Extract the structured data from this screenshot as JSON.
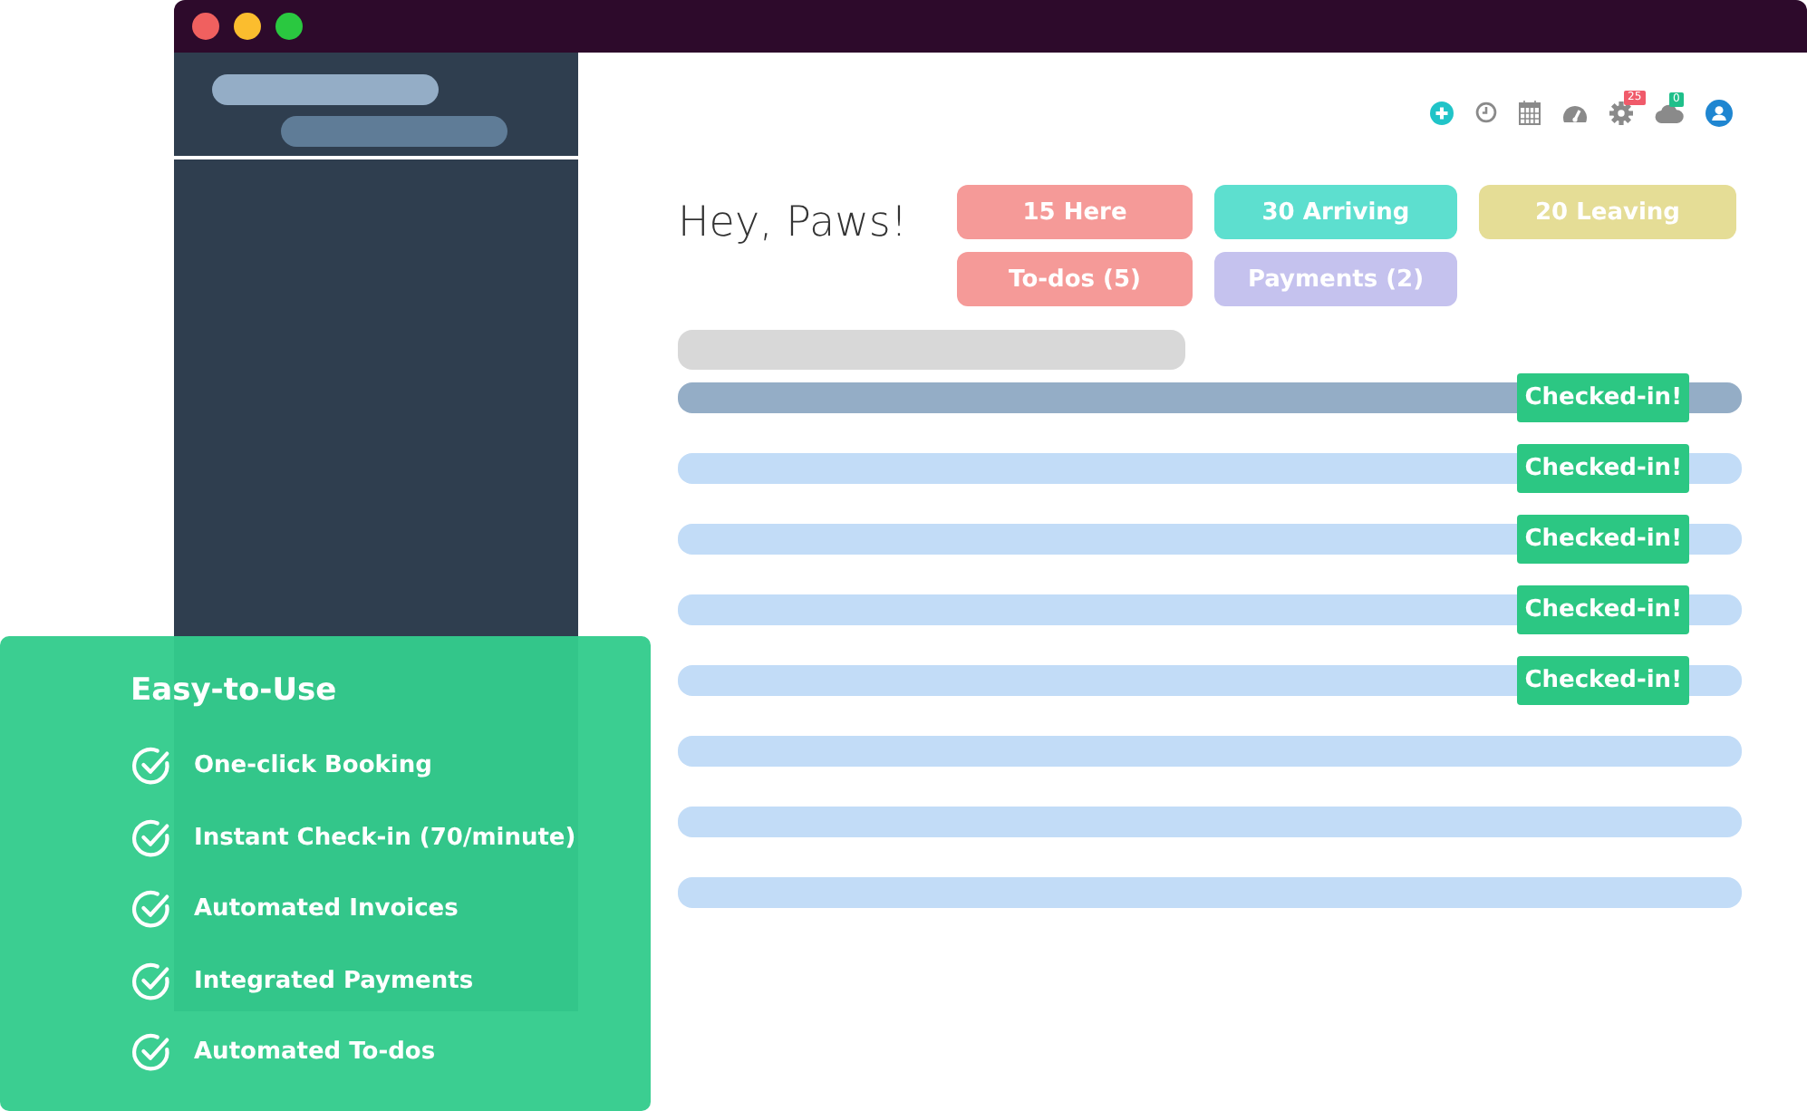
{
  "toolbar": [
    {
      "kind": "add"
    },
    {
      "kind": "clock"
    },
    {
      "kind": "calendar"
    },
    {
      "kind": "gauge"
    },
    {
      "kind": "settings",
      "badge": "25",
      "color": "#f05a6a"
    },
    {
      "kind": "cloud",
      "badge": "0",
      "color": "#1fbf8a"
    },
    {
      "kind": "user"
    }
  ],
  "greeting": "Hey, Paws!",
  "stats": [
    {
      "label": "15 Here",
      "color": "#f59a98"
    },
    {
      "label": "30 Arriving",
      "color": "#5ddfcf"
    },
    {
      "label": "20 Leaving",
      "color": "#e5dd96"
    },
    {
      "label": "To-dos (5)",
      "color": "#f59a98"
    },
    {
      "label": "Payments (2)",
      "color": "#c5c2ee"
    }
  ],
  "rows": [
    {
      "selected": true,
      "status": "Checked-in!"
    },
    {
      "selected": false,
      "status": "Checked-in!"
    },
    {
      "selected": false,
      "status": "Checked-in!"
    },
    {
      "selected": false,
      "status": "Checked-in!"
    },
    {
      "selected": false,
      "status": "Checked-in!"
    },
    {
      "selected": false
    },
    {
      "selected": false
    },
    {
      "selected": false
    }
  ],
  "feature_card": {
    "title": "Easy-to-Use",
    "items": [
      "One-click Booking",
      "Instant Check-in (70/minute)",
      "Automated Invoices",
      "Integrated Payments",
      "Automated To-dos"
    ]
  }
}
